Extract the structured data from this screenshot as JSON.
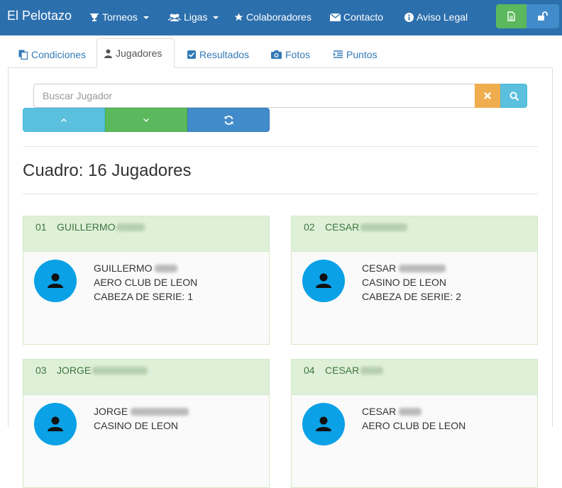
{
  "navbar": {
    "brand": "El Pelotazo",
    "items": [
      {
        "label": "Torneos",
        "icon": "trophy-icon",
        "dropdown": true
      },
      {
        "label": "Ligas",
        "icon": "users-icon",
        "dropdown": true
      },
      {
        "label": "Colaboradores",
        "icon": "star-icon",
        "dropdown": false
      },
      {
        "label": "Contacto",
        "icon": "envelope-icon",
        "dropdown": false
      },
      {
        "label": "Aviso Legal",
        "icon": "info-icon",
        "dropdown": false
      }
    ],
    "right_buttons": [
      {
        "icon": "document-icon",
        "color": "#5cb85c"
      },
      {
        "icon": "unlock-icon",
        "color": "#428bca"
      }
    ]
  },
  "tabs": [
    {
      "label": "Condiciones",
      "icon": "copy-icon",
      "active": false
    },
    {
      "label": "Jugadores",
      "icon": "user-icon",
      "active": true
    },
    {
      "label": "Resultados",
      "icon": "checkbox-icon",
      "active": false
    },
    {
      "label": "Fotos",
      "icon": "camera-icon",
      "active": false
    },
    {
      "label": "Puntos",
      "icon": "indent-icon",
      "active": false
    }
  ],
  "search": {
    "placeholder": "Buscar Jugador",
    "value": ""
  },
  "controls": {
    "up_icon": "chevron-up-icon",
    "down_icon": "chevron-down-icon",
    "refresh_icon": "refresh-icon"
  },
  "page_title": "Cuadro: 16 Jugadores",
  "players": [
    {
      "num": "01",
      "first_name": "GUILLERMO",
      "club": "AERO CLUB DE LEON",
      "seed": "CABEZA DE SERIE: 1"
    },
    {
      "num": "02",
      "first_name": "CESAR",
      "club": "CASINO DE LEON",
      "seed": "CABEZA DE SERIE: 2"
    },
    {
      "num": "03",
      "first_name": "JORGE",
      "club": "CASINO DE LEON",
      "seed": ""
    },
    {
      "num": "04",
      "first_name": "CESAR",
      "club": "AERO CLUB DE LEON",
      "seed": ""
    }
  ],
  "colors": {
    "navbar": "#2c6fad",
    "card_header": "#dff0d8",
    "card_header_text": "#3c763d",
    "avatar": "#0aa1e6"
  }
}
